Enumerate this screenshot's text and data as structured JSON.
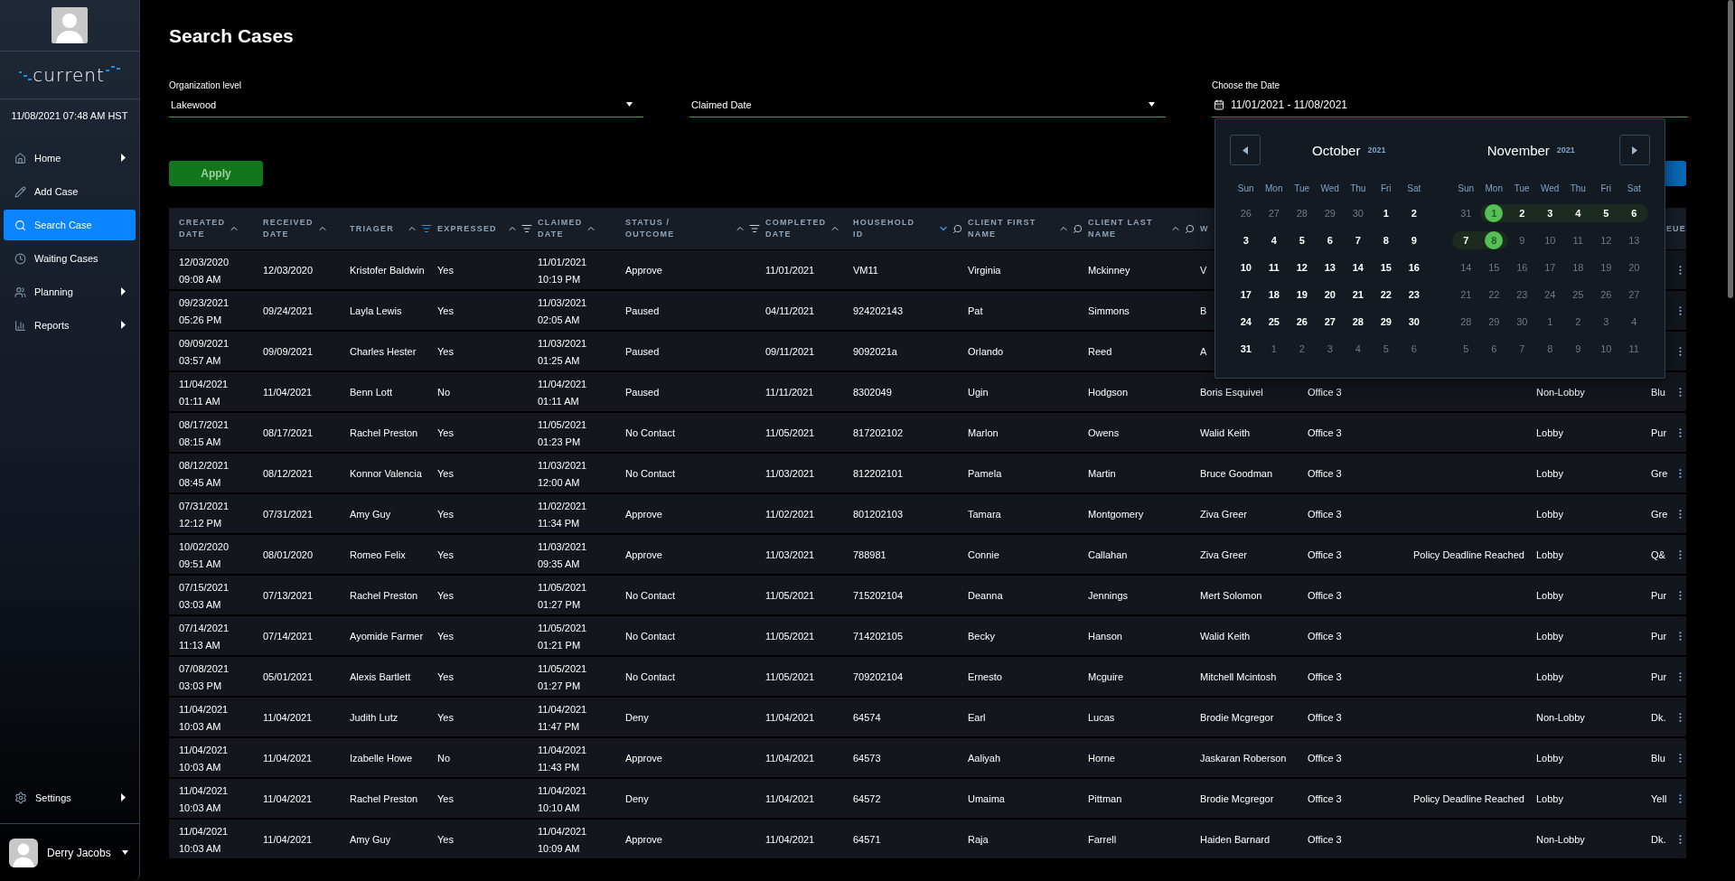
{
  "sidebar": {
    "logo": "current",
    "datetime": "11/08/2021 07:48 AM HST",
    "nav": [
      {
        "label": "Home",
        "selected": false,
        "submenu": true
      },
      {
        "label": "Add Case",
        "selected": false,
        "submenu": false
      },
      {
        "label": "Search Case",
        "selected": true,
        "submenu": false
      },
      {
        "label": "Waiting Cases",
        "selected": false,
        "submenu": false
      },
      {
        "label": "Planning",
        "selected": false,
        "submenu": true
      },
      {
        "label": "Reports",
        "selected": false,
        "submenu": true
      }
    ],
    "settings": {
      "label": "Settings",
      "submenu": true
    },
    "user": {
      "name": "Derry Jacobs"
    }
  },
  "page": {
    "title": "Search Cases"
  },
  "filters": {
    "org": {
      "label": "Organization level",
      "value": "Lakewood"
    },
    "date_type": {
      "value": "Claimed Date"
    },
    "date_range": {
      "label": "Choose the Date",
      "value": "11/01/2021 - 11/08/2021"
    }
  },
  "apply_button": "Apply",
  "calendar": {
    "months": [
      {
        "name": "October",
        "year": "2021",
        "day_names": [
          "Sun",
          "Mon",
          "Tue",
          "Wed",
          "Thu",
          "Fri",
          "Sat"
        ],
        "days": [
          {
            "label": "26",
            "muted": true,
            "selected": false,
            "in_range": false
          },
          {
            "label": "27",
            "muted": true,
            "selected": false,
            "in_range": false
          },
          {
            "label": "28",
            "muted": true,
            "selected": false,
            "in_range": false
          },
          {
            "label": "29",
            "muted": true,
            "selected": false,
            "in_range": false
          },
          {
            "label": "30",
            "muted": true,
            "selected": false,
            "in_range": false
          },
          {
            "label": "1",
            "muted": false,
            "selected": false,
            "in_range": false
          },
          {
            "label": "2",
            "muted": false,
            "selected": false,
            "in_range": false
          },
          {
            "label": "3",
            "muted": false,
            "selected": false,
            "in_range": false
          },
          {
            "label": "4",
            "muted": false,
            "selected": false,
            "in_range": false
          },
          {
            "label": "5",
            "muted": false,
            "selected": false,
            "in_range": false
          },
          {
            "label": "6",
            "muted": false,
            "selected": false,
            "in_range": false
          },
          {
            "label": "7",
            "muted": false,
            "selected": false,
            "in_range": false
          },
          {
            "label": "8",
            "muted": false,
            "selected": false,
            "in_range": false
          },
          {
            "label": "9",
            "muted": false,
            "selected": false,
            "in_range": false
          },
          {
            "label": "10",
            "muted": false,
            "selected": false,
            "in_range": false
          },
          {
            "label": "11",
            "muted": false,
            "selected": false,
            "in_range": false
          },
          {
            "label": "12",
            "muted": false,
            "selected": false,
            "in_range": false
          },
          {
            "label": "13",
            "muted": false,
            "selected": false,
            "in_range": false
          },
          {
            "label": "14",
            "muted": false,
            "selected": false,
            "in_range": false
          },
          {
            "label": "15",
            "muted": false,
            "selected": false,
            "in_range": false
          },
          {
            "label": "16",
            "muted": false,
            "selected": false,
            "in_range": false
          },
          {
            "label": "17",
            "muted": false,
            "selected": false,
            "in_range": false
          },
          {
            "label": "18",
            "muted": false,
            "selected": false,
            "in_range": false
          },
          {
            "label": "19",
            "muted": false,
            "selected": false,
            "in_range": false
          },
          {
            "label": "20",
            "muted": false,
            "selected": false,
            "in_range": false
          },
          {
            "label": "21",
            "muted": false,
            "selected": false,
            "in_range": false
          },
          {
            "label": "22",
            "muted": false,
            "selected": false,
            "in_range": false
          },
          {
            "label": "23",
            "muted": false,
            "selected": false,
            "in_range": false
          },
          {
            "label": "24",
            "muted": false,
            "selected": false,
            "in_range": false
          },
          {
            "label": "25",
            "muted": false,
            "selected": false,
            "in_range": false
          },
          {
            "label": "26",
            "muted": false,
            "selected": false,
            "in_range": false
          },
          {
            "label": "27",
            "muted": false,
            "selected": false,
            "in_range": false
          },
          {
            "label": "28",
            "muted": false,
            "selected": false,
            "in_range": false
          },
          {
            "label": "29",
            "muted": false,
            "selected": false,
            "in_range": false
          },
          {
            "label": "30",
            "muted": false,
            "selected": false,
            "in_range": false
          },
          {
            "label": "31",
            "muted": false,
            "selected": false,
            "in_range": false
          },
          {
            "label": "1",
            "muted": true,
            "selected": false,
            "in_range": false
          },
          {
            "label": "2",
            "muted": true,
            "selected": false,
            "in_range": false
          },
          {
            "label": "3",
            "muted": true,
            "selected": false,
            "in_range": false
          },
          {
            "label": "4",
            "muted": true,
            "selected": false,
            "in_range": false
          },
          {
            "label": "5",
            "muted": true,
            "selected": false,
            "in_range": false
          },
          {
            "label": "6",
            "muted": true,
            "selected": false,
            "in_range": false
          }
        ]
      },
      {
        "name": "November",
        "year": "2021",
        "day_names": [
          "Sun",
          "Mon",
          "Tue",
          "Wed",
          "Thu",
          "Fri",
          "Sat"
        ],
        "days": [
          {
            "label": "31",
            "muted": true,
            "selected": false,
            "in_range": false
          },
          {
            "label": "1",
            "muted": false,
            "selected": true,
            "in_range": true
          },
          {
            "label": "2",
            "muted": false,
            "selected": false,
            "in_range": true
          },
          {
            "label": "3",
            "muted": false,
            "selected": false,
            "in_range": true
          },
          {
            "label": "4",
            "muted": false,
            "selected": false,
            "in_range": true
          },
          {
            "label": "5",
            "muted": false,
            "selected": false,
            "in_range": true
          },
          {
            "label": "6",
            "muted": false,
            "selected": false,
            "in_range": true
          },
          {
            "label": "7",
            "muted": false,
            "selected": false,
            "in_range": true
          },
          {
            "label": "8",
            "muted": false,
            "selected": true,
            "in_range": true
          },
          {
            "label": "9",
            "muted": true,
            "selected": false,
            "in_range": false
          },
          {
            "label": "10",
            "muted": true,
            "selected": false,
            "in_range": false
          },
          {
            "label": "11",
            "muted": true,
            "selected": false,
            "in_range": false
          },
          {
            "label": "12",
            "muted": true,
            "selected": false,
            "in_range": false
          },
          {
            "label": "13",
            "muted": true,
            "selected": false,
            "in_range": false
          },
          {
            "label": "14",
            "muted": true,
            "selected": false,
            "in_range": false
          },
          {
            "label": "15",
            "muted": true,
            "selected": false,
            "in_range": false
          },
          {
            "label": "16",
            "muted": true,
            "selected": false,
            "in_range": false
          },
          {
            "label": "17",
            "muted": true,
            "selected": false,
            "in_range": false
          },
          {
            "label": "18",
            "muted": true,
            "selected": false,
            "in_range": false
          },
          {
            "label": "19",
            "muted": true,
            "selected": false,
            "in_range": false
          },
          {
            "label": "20",
            "muted": true,
            "selected": false,
            "in_range": false
          },
          {
            "label": "21",
            "muted": true,
            "selected": false,
            "in_range": false
          },
          {
            "label": "22",
            "muted": true,
            "selected": false,
            "in_range": false
          },
          {
            "label": "23",
            "muted": true,
            "selected": false,
            "in_range": false
          },
          {
            "label": "24",
            "muted": true,
            "selected": false,
            "in_range": false
          },
          {
            "label": "25",
            "muted": true,
            "selected": false,
            "in_range": false
          },
          {
            "label": "26",
            "muted": true,
            "selected": false,
            "in_range": false
          },
          {
            "label": "27",
            "muted": true,
            "selected": false,
            "in_range": false
          },
          {
            "label": "28",
            "muted": true,
            "selected": false,
            "in_range": false
          },
          {
            "label": "29",
            "muted": true,
            "selected": false,
            "in_range": false
          },
          {
            "label": "30",
            "muted": true,
            "selected": false,
            "in_range": false
          },
          {
            "label": "1",
            "muted": true,
            "selected": false,
            "in_range": false
          },
          {
            "label": "2",
            "muted": true,
            "selected": false,
            "in_range": false
          },
          {
            "label": "3",
            "muted": true,
            "selected": false,
            "in_range": false
          },
          {
            "label": "4",
            "muted": true,
            "selected": false,
            "in_range": false
          },
          {
            "label": "5",
            "muted": true,
            "selected": false,
            "in_range": false
          },
          {
            "label": "6",
            "muted": true,
            "selected": false,
            "in_range": false
          },
          {
            "label": "7",
            "muted": true,
            "selected": false,
            "in_range": false
          },
          {
            "label": "8",
            "muted": true,
            "selected": false,
            "in_range": false
          },
          {
            "label": "9",
            "muted": true,
            "selected": false,
            "in_range": false
          },
          {
            "label": "10",
            "muted": true,
            "selected": false,
            "in_range": false
          },
          {
            "label": "11",
            "muted": true,
            "selected": false,
            "in_range": false
          }
        ]
      }
    ]
  },
  "table": {
    "columns": [
      {
        "label": "CREATED\nDATE",
        "kind": "sort",
        "sort_desc": false,
        "sort_active": false
      },
      {
        "label": "RECEIVED\nDATE",
        "kind": "sort",
        "sort_desc": false,
        "sort_active": false
      },
      {
        "label": "TRIAGER",
        "kind": "sort_filter",
        "sort_desc": false,
        "sort_active": false,
        "filter_active": true
      },
      {
        "label": "EXPRESSED",
        "kind": "sort_filter",
        "sort_desc": false,
        "sort_active": false,
        "filter_active": false
      },
      {
        "label": "CLAIMED\nDATE",
        "kind": "sort",
        "sort_desc": false,
        "sort_active": false
      },
      {
        "label": "STATUS /\nOUTCOME",
        "kind": "sort_filter",
        "sort_desc": false,
        "sort_active": false,
        "filter_active": false
      },
      {
        "label": "COMPLETED\nDATE",
        "kind": "sort",
        "sort_desc": false,
        "sort_active": false
      },
      {
        "label": "HOUSEHOLD\nID",
        "kind": "sort_search",
        "sort_desc": true,
        "sort_active": true
      },
      {
        "label": "CLIENT FIRST\nNAME",
        "kind": "sort_search",
        "sort_desc": false,
        "sort_active": false
      },
      {
        "label": "CLIENT LAST\nNAME",
        "kind": "sort_search",
        "sort_desc": false,
        "sort_active": false
      },
      {
        "label": "W",
        "kind": "plain"
      },
      {
        "kind": "hidden"
      },
      {
        "kind": "hidden"
      },
      {
        "kind": "hidden"
      },
      {
        "label": "EUE",
        "kind": "plain"
      }
    ],
    "rows": [
      {
        "created": "12/03/2020\n09:08 AM",
        "received": "12/03/2020",
        "triager": "Kristofer Baldwin",
        "expressed": "Yes",
        "claimed": "11/01/2021\n10:19 PM",
        "status": "Approve",
        "completed": "11/01/2021",
        "household_id": "VM11",
        "first_name": "Virginia",
        "last_name": "Mckinney",
        "worker": "V"
      },
      {
        "created": "09/23/2021\n05:26 PM",
        "received": "09/24/2021",
        "triager": "Layla Lewis",
        "expressed": "Yes",
        "claimed": "11/03/2021\n02:05 AM",
        "status": "Paused",
        "completed": "04/11/2021",
        "household_id": "924202143",
        "first_name": "Pat",
        "last_name": "Simmons",
        "worker": "B"
      },
      {
        "created": "09/09/2021\n03:57 AM",
        "received": "09/09/2021",
        "triager": "Charles Hester",
        "expressed": "Yes",
        "claimed": "11/03/2021\n01:25 AM",
        "status": "Paused",
        "completed": "09/11/2021",
        "household_id": "9092021a",
        "first_name": "Orlando",
        "last_name": "Reed",
        "worker": "A"
      },
      {
        "created": "11/04/2021\n01:11 AM",
        "received": "11/04/2021",
        "triager": "Benn Lott",
        "expressed": "No",
        "claimed": "11/04/2021\n01:11 AM",
        "status": "Paused",
        "completed": "11/11/2021",
        "household_id": "8302049",
        "first_name": "Ugin",
        "last_name": "Hodgson",
        "worker": "Boris Esquivel",
        "office": "Office 3",
        "lobby": "Non-Lobby",
        "queue": "Blu"
      },
      {
        "created": "08/17/2021\n08:15 AM",
        "received": "08/17/2021",
        "triager": "Rachel Preston",
        "expressed": "Yes",
        "claimed": "11/05/2021\n01:23 PM",
        "status": "No Contact",
        "completed": "11/05/2021",
        "household_id": "817202102",
        "first_name": "Marlon",
        "last_name": "Owens",
        "worker": "Walid Keith",
        "office": "Office 3",
        "lobby": "Lobby",
        "queue": "Pur"
      },
      {
        "created": "08/12/2021\n08:45 AM",
        "received": "08/12/2021",
        "triager": "Konnor Valencia",
        "expressed": "Yes",
        "claimed": "11/03/2021\n12:00 AM",
        "status": "No Contact",
        "completed": "11/03/2021",
        "household_id": "812202101",
        "first_name": "Pamela",
        "last_name": "Martin",
        "worker": "Bruce Goodman",
        "office": "Office 3",
        "lobby": "Lobby",
        "queue": "Gre"
      },
      {
        "created": "07/31/2021\n12:12 PM",
        "received": "07/31/2021",
        "triager": "Amy Guy",
        "expressed": "Yes",
        "claimed": "11/02/2021\n11:34 PM",
        "status": "Approve",
        "completed": "11/02/2021",
        "household_id": "801202103",
        "first_name": "Tamara",
        "last_name": "Montgomery",
        "worker": "Ziva Greer",
        "office": "Office 3",
        "lobby": "Lobby",
        "queue": "Gre"
      },
      {
        "created": "10/02/2020\n09:51 AM",
        "received": "08/01/2020",
        "triager": "Romeo Felix",
        "expressed": "Yes",
        "claimed": "11/03/2021\n09:35 AM",
        "status": "Approve",
        "completed": "11/03/2021",
        "household_id": "788981",
        "first_name": "Connie",
        "last_name": "Callahan",
        "worker": "Ziva Greer",
        "office": "Office 3",
        "note": "Policy Deadline Reached",
        "lobby": "Lobby",
        "queue": "Q&"
      },
      {
        "created": "07/15/2021\n03:03 AM",
        "received": "07/13/2021",
        "triager": "Rachel Preston",
        "expressed": "Yes",
        "claimed": "11/05/2021\n01:27 PM",
        "status": "No Contact",
        "completed": "11/05/2021",
        "household_id": "715202104",
        "first_name": "Deanna",
        "last_name": "Jennings",
        "worker": "Mert Solomon",
        "office": "Office 3",
        "lobby": "Lobby",
        "queue": "Pur"
      },
      {
        "created": "07/14/2021\n11:13 AM",
        "received": "07/14/2021",
        "triager": "Ayomide Farmer",
        "expressed": "Yes",
        "claimed": "11/05/2021\n01:21 PM",
        "status": "No Contact",
        "completed": "11/05/2021",
        "household_id": "714202105",
        "first_name": "Becky",
        "last_name": "Hanson",
        "worker": "Walid Keith",
        "office": "Office 3",
        "lobby": "Lobby",
        "queue": "Pur"
      },
      {
        "created": "07/08/2021\n03:03 PM",
        "received": "05/01/2021",
        "triager": "Alexis Bartlett",
        "expressed": "Yes",
        "claimed": "11/05/2021\n01:27 PM",
        "status": "No Contact",
        "completed": "11/05/2021",
        "household_id": "709202104",
        "first_name": "Ernesto",
        "last_name": "Mcguire",
        "worker": "Mitchell Mcintosh",
        "office": "Office 3",
        "lobby": "Lobby",
        "queue": "Pur"
      },
      {
        "created": "11/04/2021\n10:03 AM",
        "received": "11/04/2021",
        "triager": "Judith Lutz",
        "expressed": "Yes",
        "claimed": "11/04/2021\n11:47 PM",
        "status": "Deny",
        "completed": "11/04/2021",
        "household_id": "64574",
        "first_name": "Earl",
        "last_name": "Lucas",
        "worker": "Brodie Mcgregor",
        "office": "Office 3",
        "lobby": "Non-Lobby",
        "queue": "Dk."
      },
      {
        "created": "11/04/2021\n10:03 AM",
        "received": "11/04/2021",
        "triager": "Izabelle Howe",
        "expressed": "No",
        "claimed": "11/04/2021\n11:43 PM",
        "status": "Approve",
        "completed": "11/04/2021",
        "household_id": "64573",
        "first_name": "Aaliyah",
        "last_name": "Horne",
        "worker": "Jaskaran Roberson",
        "office": "Office 3",
        "lobby": "Lobby",
        "queue": "Blu"
      },
      {
        "created": "11/04/2021\n10:03 AM",
        "received": "11/04/2021",
        "triager": "Rachel Preston",
        "expressed": "Yes",
        "claimed": "11/04/2021\n10:10 AM",
        "status": "Deny",
        "completed": "11/04/2021",
        "household_id": "64572",
        "first_name": "Umaima",
        "last_name": "Pittman",
        "worker": "Brodie Mcgregor",
        "office": "Office 3",
        "note": "Policy Deadline Reached",
        "lobby": "Lobby",
        "queue": "Yell"
      },
      {
        "created": "11/04/2021\n10:03 AM",
        "received": "11/04/2021",
        "triager": "Amy Guy",
        "expressed": "Yes",
        "claimed": "11/04/2021\n10:09 AM",
        "status": "Approve",
        "completed": "11/04/2021",
        "household_id": "64571",
        "first_name": "Raja",
        "last_name": "Farrell",
        "worker": "Haiden Barnard",
        "office": "Office 3",
        "lobby": "Non-Lobby",
        "queue": "Dk."
      }
    ]
  }
}
